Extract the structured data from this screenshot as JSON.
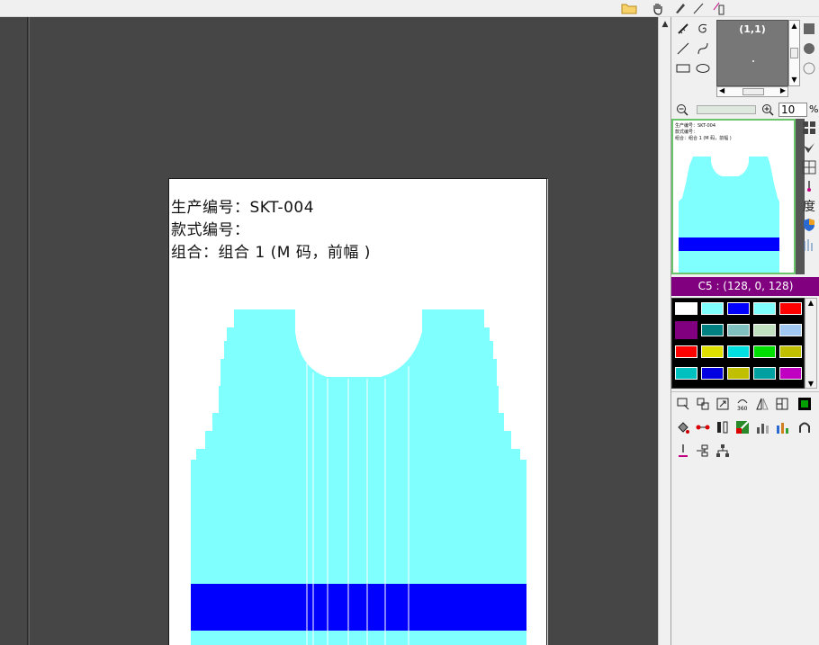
{
  "toolbar": {
    "icons": [
      "folder-icon",
      "hand-icon",
      "pen-icon",
      "line-icon",
      "marker-icon"
    ]
  },
  "paper": {
    "line1": "生产编号：SKT-004",
    "line2": "款式编号：",
    "line3": "组合：组合 1 (M 码，前幅 )"
  },
  "navigator": {
    "coord": "(1,1)"
  },
  "zoom": {
    "value": "10",
    "unit": "%"
  },
  "current_color": {
    "label": "C5 : (128, 0, 128)",
    "hex": "#800080"
  },
  "palette": {
    "rows": [
      [
        "#ffffff",
        "#80ffff",
        "#0000ff",
        "#80ffff",
        "#ff0000"
      ],
      [
        "#800080",
        "#008080",
        "#80c0c0",
        "#c0e0c0",
        "#a0c8f0"
      ],
      [
        "#ff0000",
        "#e0e000",
        "#00e0e0",
        "#00e000",
        "#c0c000"
      ],
      [
        "#00c0c0",
        "#0000e0",
        "#c0c000",
        "#00a0a0",
        "#c000c0"
      ]
    ]
  },
  "garment": {
    "body_color": "#80ffff",
    "band_color": "#0000ff"
  },
  "thumbnail": {
    "line1": "生产编号：SKT-004",
    "line2": "款式编号：",
    "line3": "组合：组合 1 (M 码，前幅 )"
  }
}
